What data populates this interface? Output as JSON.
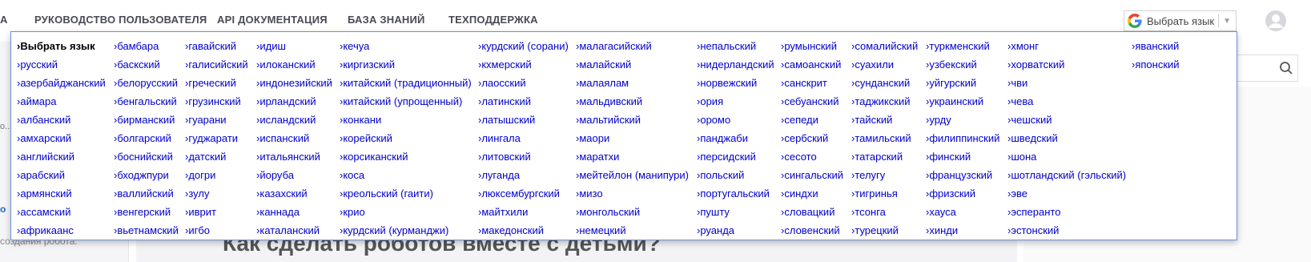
{
  "nav": {
    "cut_item": "А",
    "items": [
      "РУКОВОДСТВО ПОЛЬЗОВАТЕЛЯ",
      "API ДОКУМЕНТАЦИЯ",
      "БАЗА ЗНАНИЙ",
      "ТЕХПОДДЕРЖКА"
    ]
  },
  "translate": {
    "label": "Выбрать язык",
    "arrow": "▼"
  },
  "background": {
    "left_snip": "о...",
    "left_snip2": "о",
    "left_foot": "создания робота.",
    "article_title": "Как сделать роботов вместе с детьми?"
  },
  "languages": {
    "columns": [
      [
        "Выбрать язык",
        "русский",
        "азербайджанский",
        "аймара",
        "албанский",
        "амхарский",
        "английский",
        "арабский",
        "армянский",
        "ассамский",
        "африкаанс"
      ],
      [
        "бамбара",
        "баскский",
        "белорусский",
        "бенгальский",
        "бирманский",
        "болгарский",
        "боснийский",
        "бходжпури",
        "валлийский",
        "венгерский",
        "вьетнамский"
      ],
      [
        "гавайский",
        "галисийский",
        "греческий",
        "грузинский",
        "гуарани",
        "гуджарати",
        "датский",
        "догри",
        "зулу",
        "иврит",
        "игбо"
      ],
      [
        "идиш",
        "илоканский",
        "индонезийский",
        "ирландский",
        "исландский",
        "испанский",
        "итальянский",
        "йоруба",
        "казахский",
        "каннада",
        "каталанский"
      ],
      [
        "кечуа",
        "киргизский",
        "китайский (традиционный)",
        "китайский (упрощенный)",
        "конкани",
        "корейский",
        "корсиканский",
        "коса",
        "креольский (гаити)",
        "крио",
        "курдский (курманджи)"
      ],
      [
        "курдский (сорани)",
        "кхмерский",
        "лаосский",
        "латинский",
        "латышский",
        "лингала",
        "литовский",
        "луганда",
        "люксембургский",
        "майтхили",
        "македонский"
      ],
      [
        "малагасийский",
        "малайский",
        "малаялам",
        "мальдивский",
        "мальтийский",
        "маори",
        "маратхи",
        "мейтейлон (манипури)",
        "мизо",
        "монгольский",
        "немецкий"
      ],
      [
        "непальский",
        "нидерландский",
        "норвежский",
        "ория",
        "оромо",
        "панджаби",
        "персидский",
        "польский",
        "португальский",
        "пушту",
        "руанда"
      ],
      [
        "румынский",
        "самоанский",
        "санскрит",
        "себуанский",
        "сепеди",
        "сербский",
        "сесото",
        "сингальский",
        "синдхи",
        "словацкий",
        "словенский"
      ],
      [
        "сомалийский",
        "суахили",
        "сунданский",
        "таджикский",
        "тайский",
        "тамильский",
        "татарский",
        "телугу",
        "тигринья",
        "тсонга",
        "турецкий"
      ],
      [
        "туркменский",
        "узбекский",
        "уйгурский",
        "украинский",
        "урду",
        "филиппинский",
        "финский",
        "французский",
        "фризский",
        "хауса",
        "хинди"
      ],
      [
        "хмонг",
        "хорватский",
        "чви",
        "чева",
        "чешский",
        "шведский",
        "шона",
        "шотландский (гэльский)",
        "эве",
        "эсперанто",
        "эстонский"
      ],
      [
        "яванский",
        "японский"
      ]
    ]
  }
}
